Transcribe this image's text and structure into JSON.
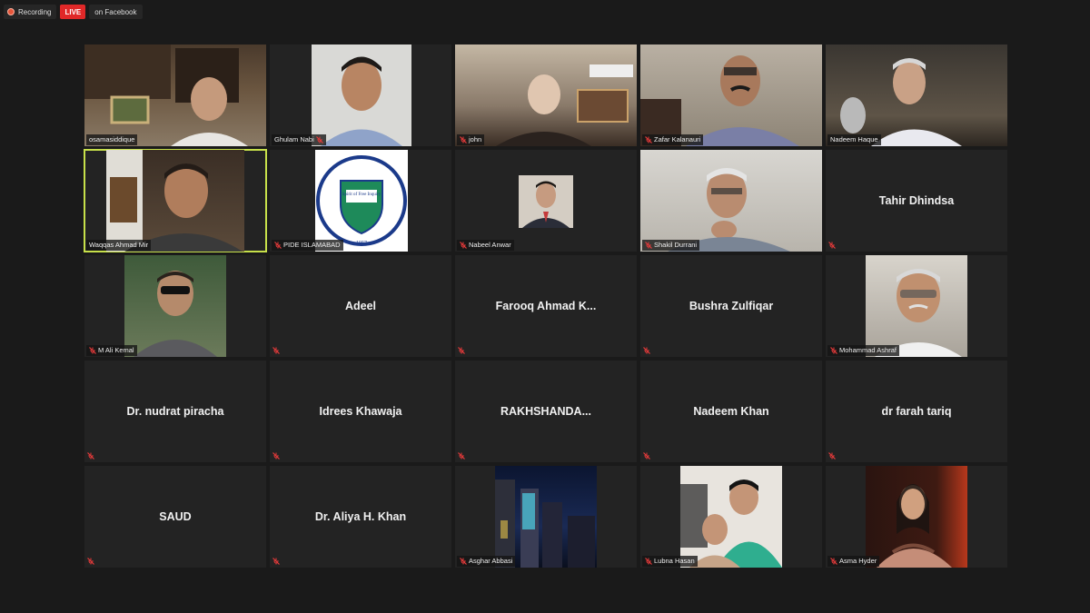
{
  "topbar": {
    "recording_label": "Recording",
    "live_label": "LIVE",
    "platform_label": "on Facebook"
  },
  "colors": {
    "background": "#1a1a1a",
    "tile": "#232323",
    "active_speaker": "#c7e04a",
    "live": "#e02828",
    "muted_icon": "#e63a3a"
  },
  "participants": [
    {
      "name": "osamasiddique",
      "video": true,
      "muted": false
    },
    {
      "name": "Ghulam Nabi",
      "video": true,
      "muted": true
    },
    {
      "name": "john",
      "video": true,
      "muted": true
    },
    {
      "name": "Zafar Kalanauri",
      "video": true,
      "muted": true
    },
    {
      "name": "Nadeem Haque",
      "video": true,
      "muted": false
    },
    {
      "name": "Waqqas Ahmad Mir",
      "video": true,
      "muted": false,
      "active_speaker": true
    },
    {
      "name": "PIDE ISLAMABAD",
      "video": true,
      "muted": true,
      "logo_text": "Spirit of Free Inquiry",
      "logo_year": "1957",
      "logo_arc": "Pakistan Institute of Development Economics"
    },
    {
      "name": "Nabeel Anwar",
      "video": true,
      "muted": true
    },
    {
      "name": "Shakil Durrani",
      "video": true,
      "muted": true
    },
    {
      "name": "Tahir Dhindsa",
      "video": false,
      "muted": true
    },
    {
      "name": "M Ali Kemal",
      "video": true,
      "muted": true
    },
    {
      "name": "Adeel",
      "video": false,
      "muted": true
    },
    {
      "name": "Farooq Ahmad K...",
      "video": false,
      "muted": true
    },
    {
      "name": "Bushra Zulfiqar",
      "video": false,
      "muted": true
    },
    {
      "name": "Mohammad Ashraf",
      "video": true,
      "muted": true
    },
    {
      "name": "Dr. nudrat piracha",
      "video": false,
      "muted": true
    },
    {
      "name": "Idrees Khawaja",
      "video": false,
      "muted": true
    },
    {
      "name": "RAKHSHANDA...",
      "video": false,
      "muted": true
    },
    {
      "name": "Nadeem Khan",
      "video": false,
      "muted": true
    },
    {
      "name": "dr farah tariq",
      "video": false,
      "muted": true
    },
    {
      "name": "SAUD",
      "video": false,
      "muted": true
    },
    {
      "name": "Dr. Aliya H. Khan",
      "video": false,
      "muted": true
    },
    {
      "name": "Asghar Abbasi",
      "video": true,
      "muted": true
    },
    {
      "name": "Lubna Hasan",
      "video": true,
      "muted": true
    },
    {
      "name": "Asma Hyder",
      "video": true,
      "muted": true
    }
  ]
}
